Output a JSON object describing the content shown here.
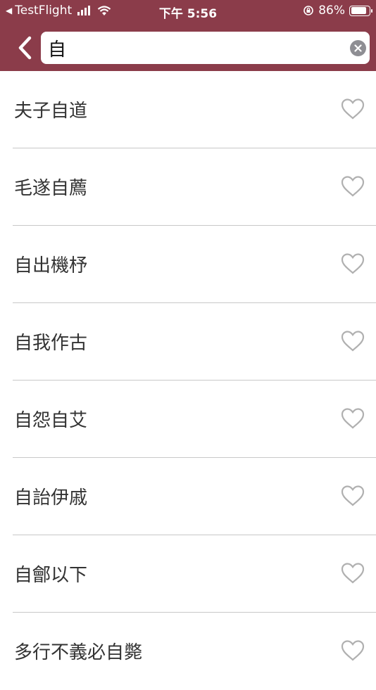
{
  "status_bar": {
    "back_app": "TestFlight",
    "time": "下午 5:56",
    "battery": "86%",
    "battery_level": 0.86
  },
  "search": {
    "value": "自",
    "clear_icon": "clear-circle-icon"
  },
  "results": [
    {
      "label": "夫子自道"
    },
    {
      "label": "毛遂自薦"
    },
    {
      "label": "自出機杼"
    },
    {
      "label": "自我作古"
    },
    {
      "label": "自怨自艾"
    },
    {
      "label": "自詒伊戚"
    },
    {
      "label": "自鄶以下"
    },
    {
      "label": "多行不義必自斃"
    }
  ],
  "colors": {
    "header": "#8b3c4a",
    "heart": "#b0b0b0"
  }
}
